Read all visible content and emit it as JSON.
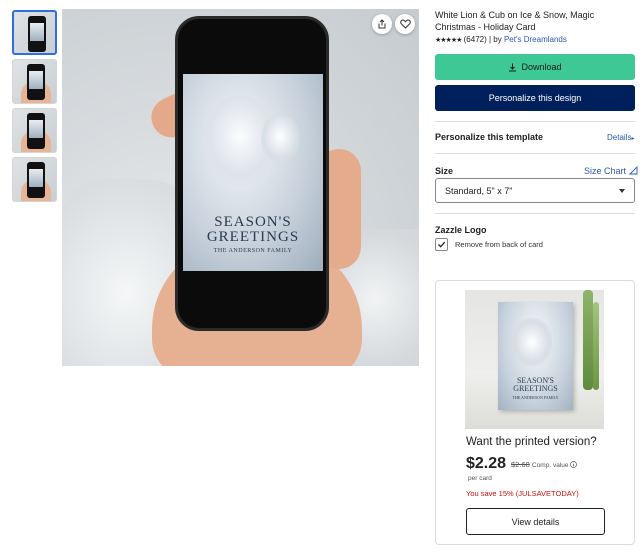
{
  "product": {
    "title": "White Lion & Cub on Ice & Snow, Magic Christmas - Holiday Card",
    "stars": "★★★★★",
    "review_count": "(6472)",
    "by_prefix": "| by",
    "store": "Pet's Dreamlands"
  },
  "card_text": {
    "line1": "SEASON'S",
    "line2": "GREETINGS",
    "line3": "THE ANDERSON FAMILY"
  },
  "actions": {
    "download_label": "Download",
    "personalize_label": "Personalize this design"
  },
  "template": {
    "heading": "Personalize this template",
    "details_label": "Details"
  },
  "size": {
    "heading": "Size",
    "chart_label": "Size Chart",
    "selected": "Standard, 5\" x 7\""
  },
  "logo": {
    "heading": "Zazzle Logo",
    "checkbox_label": "Remove from back of card",
    "checked": true
  },
  "promo": {
    "question": "Want the printed version?",
    "price": "$2.28",
    "original_price": "$2.68",
    "comp_label": "Comp. value",
    "per_card": "per card",
    "savings": "You save 15% (JULSAVETODAY)",
    "button_label": "View details"
  },
  "icons": {
    "share": "share-icon",
    "favorite": "heart-icon",
    "download": "download-icon",
    "caret": "caret-down-icon",
    "info": "info-icon"
  },
  "colors": {
    "download_button": "#3ec896",
    "personalize_button": "#00205b",
    "link": "#2a58b3",
    "savings": "#d01010",
    "active_thumb_border": "#2f6fd6"
  }
}
